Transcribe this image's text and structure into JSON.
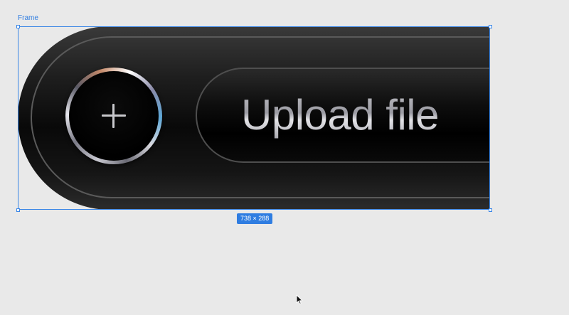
{
  "canvas": {
    "frame_label": "Frame",
    "size_badge": "738 × 288"
  },
  "component": {
    "add_icon": "plus-icon",
    "upload_label": "Upload file"
  },
  "colors": {
    "canvas_background": "#e9e9e9",
    "selection_blue": "#2f7de1",
    "pill_dark": "#0a0a0a",
    "label_silver": "#bdbdc2"
  },
  "cursor": {
    "icon": "arrow-cursor-icon"
  }
}
